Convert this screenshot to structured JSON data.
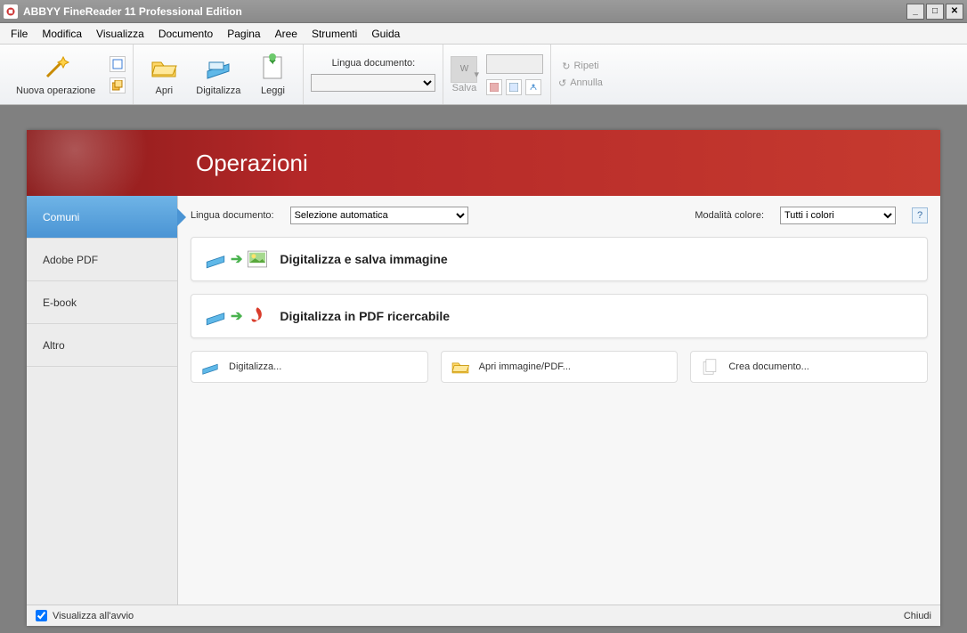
{
  "title": "ABBYY FineReader 11 Professional Edition",
  "menu": [
    "File",
    "Modifica",
    "Visualizza",
    "Documento",
    "Pagina",
    "Aree",
    "Strumenti",
    "Guida"
  ],
  "toolbar": {
    "new_op": "Nuova operazione",
    "apri": "Apri",
    "digitalizza": "Digitalizza",
    "leggi": "Leggi",
    "lang_label": "Lingua documento:",
    "salva": "Salva",
    "ripeti": "Ripeti",
    "annulla": "Annulla"
  },
  "banner_title": "Operazioni",
  "side_tabs": [
    "Comuni",
    "Adobe PDF",
    "E-book",
    "Altro"
  ],
  "active_tab_index": 0,
  "opts": {
    "lang_label": "Lingua documento:",
    "lang_value": "Selezione automatica",
    "color_label": "Modalità colore:",
    "color_value": "Tutti i colori",
    "help": "?"
  },
  "big_tasks": [
    "Digitalizza e salva immagine",
    "Digitalizza in PDF ricercabile"
  ],
  "small_tasks": [
    "Digitalizza...",
    "Apri immagine/PDF...",
    "Crea documento..."
  ],
  "status": {
    "show_startup": "Visualizza all'avvio",
    "close": "Chiudi"
  }
}
